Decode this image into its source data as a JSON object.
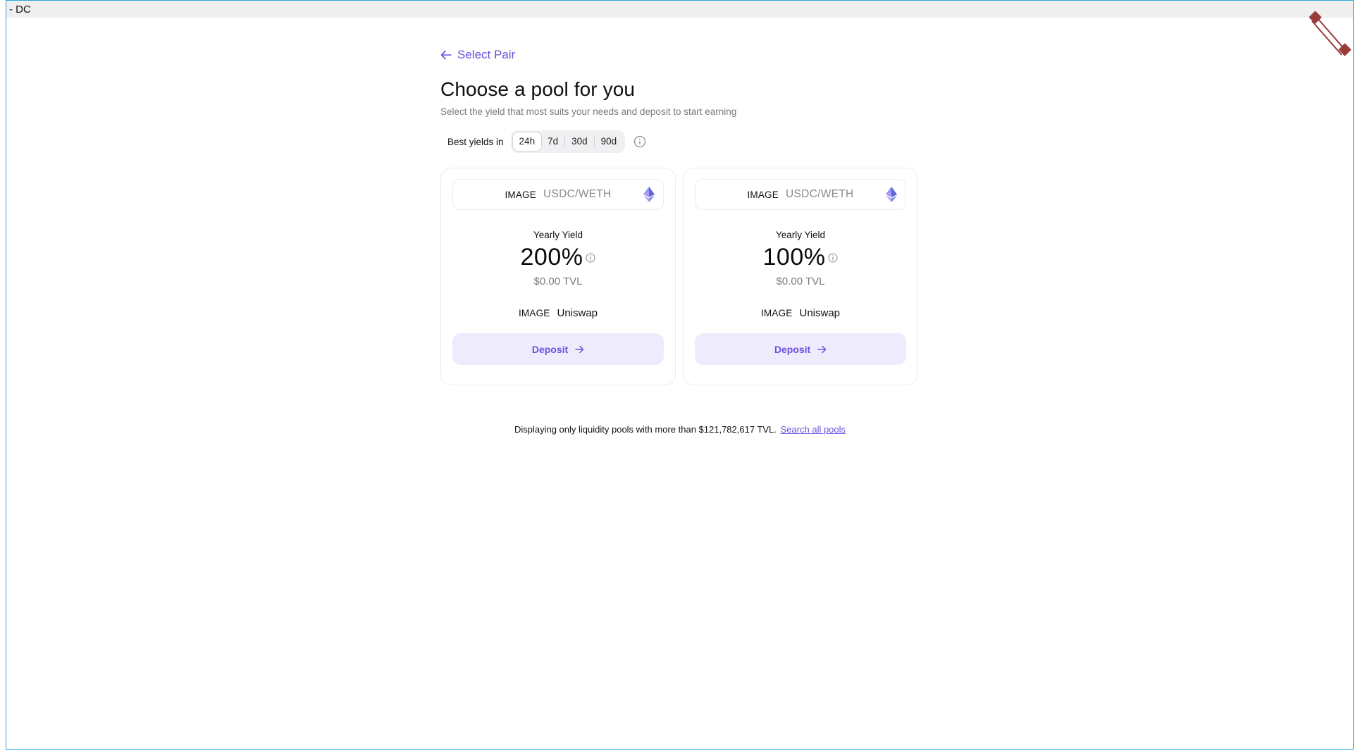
{
  "window": {
    "title": "- DC"
  },
  "header": {
    "back_label": "Select Pair",
    "title": "Choose a pool for you",
    "subtitle": "Select the yield that most suits your needs and deposit to start earning"
  },
  "filter": {
    "label": "Best yields in",
    "options": [
      "24h",
      "7d",
      "30d",
      "90d"
    ],
    "selected": "24h"
  },
  "pools": [
    {
      "image_placeholder": "IMAGE",
      "pair": "USDC/WETH",
      "chain_icon": "ethereum-icon",
      "yield_label": "Yearly Yield",
      "yield": "200%",
      "tvl": "$0.00 TVL",
      "dex_image_placeholder": "IMAGE",
      "dex": "Uniswap",
      "deposit_label": "Deposit"
    },
    {
      "image_placeholder": "IMAGE",
      "pair": "USDC/WETH",
      "chain_icon": "ethereum-icon",
      "yield_label": "Yearly Yield",
      "yield": "100%",
      "tvl": "$0.00 TVL",
      "dex_image_placeholder": "IMAGE",
      "dex": "Uniswap",
      "deposit_label": "Deposit"
    }
  ],
  "footer": {
    "note": "Displaying only liquidity pools with more than $121,782,617 TVL.",
    "link_label": "Search all pools"
  },
  "colors": {
    "accent": "#6e4fe0",
    "button_bg": "#eeebfd",
    "muted_text": "#7b7b7b",
    "frame_border": "#2aa7d8"
  }
}
